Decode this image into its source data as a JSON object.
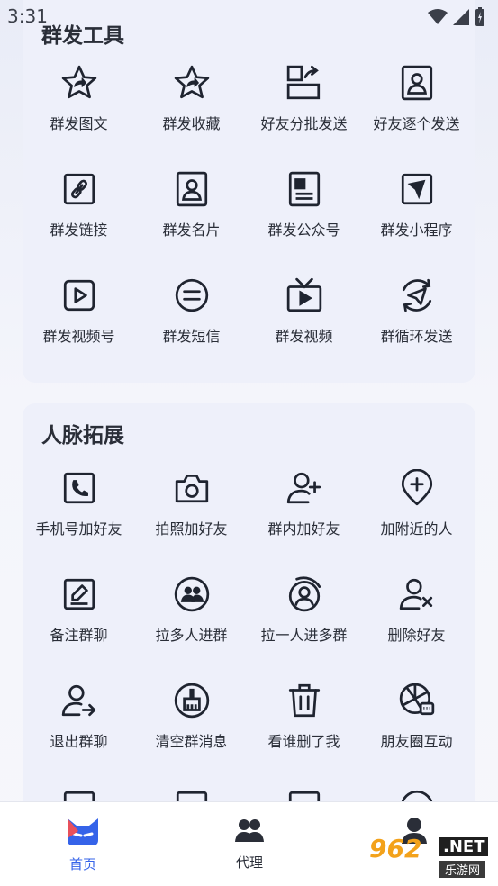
{
  "status_bar": {
    "time": "3:31"
  },
  "sections": {
    "mass_send": {
      "title": "群发工具",
      "items": [
        {
          "label": "群发图文",
          "icon": "star-share-icon"
        },
        {
          "label": "群发收藏",
          "icon": "star-share-icon"
        },
        {
          "label": "好友分批发送",
          "icon": "batch-send-icon"
        },
        {
          "label": "好友逐个发送",
          "icon": "contact-card-icon"
        },
        {
          "label": "群发链接",
          "icon": "link-icon"
        },
        {
          "label": "群发名片",
          "icon": "contact-card-icon"
        },
        {
          "label": "群发公众号",
          "icon": "article-icon"
        },
        {
          "label": "群发小程序",
          "icon": "mini-program-icon"
        },
        {
          "label": "群发视频号",
          "icon": "video-play-icon"
        },
        {
          "label": "群发短信",
          "icon": "sms-icon"
        },
        {
          "label": "群发视频",
          "icon": "tv-icon"
        },
        {
          "label": "群循环发送",
          "icon": "loop-send-icon"
        }
      ]
    },
    "network": {
      "title": "人脉拓展",
      "items": [
        {
          "label": "手机号加好友",
          "icon": "phone-icon"
        },
        {
          "label": "拍照加好友",
          "icon": "camera-icon"
        },
        {
          "label": "群内加好友",
          "icon": "add-user-icon"
        },
        {
          "label": "加附近的人",
          "icon": "location-add-icon"
        },
        {
          "label": "备注群聊",
          "icon": "edit-note-icon"
        },
        {
          "label": "拉多人进群",
          "icon": "group-users-icon"
        },
        {
          "label": "拉一人进多群",
          "icon": "user-circle-icon"
        },
        {
          "label": "删除好友",
          "icon": "remove-user-icon"
        },
        {
          "label": "退出群聊",
          "icon": "exit-user-icon"
        },
        {
          "label": "清空群消息",
          "icon": "broom-icon"
        },
        {
          "label": "看谁删了我",
          "icon": "trash-icon"
        },
        {
          "label": "朋友圈互动",
          "icon": "moments-chat-icon"
        }
      ]
    }
  },
  "tabbar": {
    "home": "首页",
    "agent": "代理"
  },
  "watermark": {
    "main": "962",
    "net": ".NET",
    "sub": "乐游网"
  },
  "colors": {
    "accent": "#3563e9",
    "icon": "#1f2430",
    "card_bg": "#eef0fa"
  }
}
